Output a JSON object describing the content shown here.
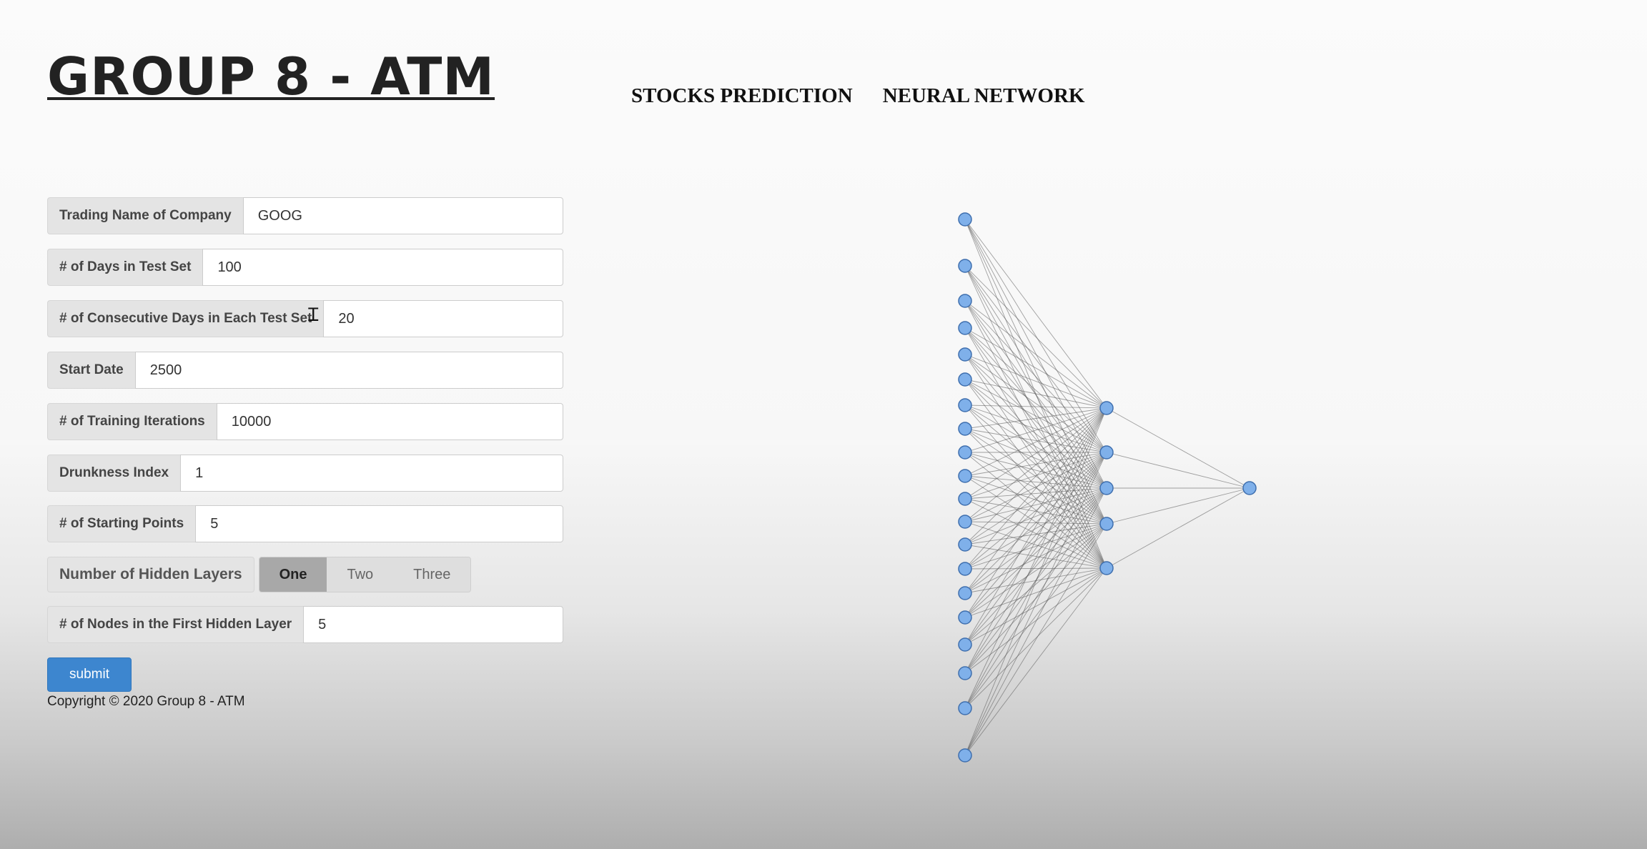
{
  "header": {
    "title": "GROUP 8 - ATM",
    "nav": [
      "STOCKS PREDICTION",
      "NEURAL NETWORK"
    ]
  },
  "form": {
    "fields": [
      {
        "label": "Trading Name of Company",
        "value": "GOOG"
      },
      {
        "label": "# of Days in Test Set",
        "value": "100"
      },
      {
        "label": "# of Consecutive Days in Each Test Set",
        "value": "20"
      },
      {
        "label": "Start Date",
        "value": "2500"
      },
      {
        "label": "# of Training Iterations",
        "value": "10000"
      },
      {
        "label": "Drunkness Index",
        "value": "1"
      },
      {
        "label": "# of Starting Points",
        "value": "5"
      }
    ],
    "hidden_layers": {
      "label": "Number of Hidden Layers",
      "options": [
        "One",
        "Two",
        "Three"
      ],
      "selected": "One"
    },
    "nodes_field": {
      "label": "# of Nodes in the First Hidden Layer",
      "value": "5"
    },
    "submit_label": "submit"
  },
  "footer": {
    "copyright": "Copyright © 2020 Group 8 - ATM"
  },
  "network": {
    "input_nodes": 20,
    "hidden_nodes": 5,
    "output_nodes": 1,
    "node_color": "#7fb0ea",
    "edge_color": "#555555"
  },
  "colors": {
    "accent": "#3d86cf"
  }
}
